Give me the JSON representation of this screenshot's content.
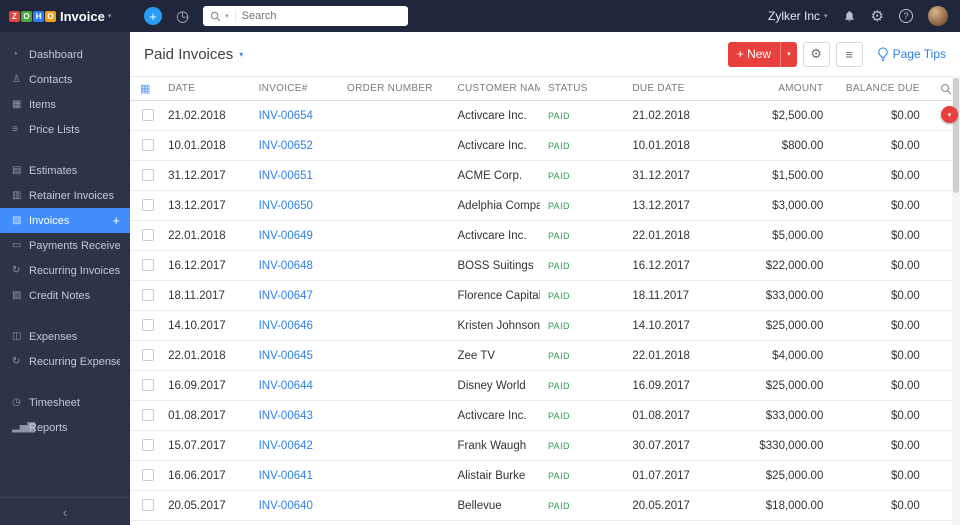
{
  "colors": {
    "accent_blue": "#408dfb",
    "brand_red": "#e8413d",
    "paid_green": "#2e9e4f",
    "link_blue": "#2f80e7",
    "topbar_bg": "#20263b",
    "sidebar_bg": "#2d3448"
  },
  "topbar": {
    "logo": {
      "letters": [
        {
          "ch": "Z",
          "color": "#e2443b"
        },
        {
          "ch": "O",
          "color": "#4ca83d"
        },
        {
          "ch": "H",
          "color": "#2d7ff0"
        },
        {
          "ch": "O",
          "color": "#f0a11b"
        }
      ],
      "product": "Invoice",
      "caret": "▾"
    },
    "icons": {
      "quick_create": "+",
      "history": "◷",
      "settings": "⚙",
      "help": "?"
    },
    "search": {
      "placeholder": "Search",
      "caret": "▾"
    },
    "org": {
      "name": "Zylker Inc",
      "caret": "▾"
    }
  },
  "sidebar": {
    "groups": [
      {
        "items": [
          {
            "label": "Dashboard",
            "icon": "◔"
          },
          {
            "label": "Contacts",
            "icon": "♙"
          },
          {
            "label": "Items",
            "icon": "▦"
          },
          {
            "label": "Price Lists",
            "icon": "≡"
          }
        ]
      },
      {
        "items": [
          {
            "label": "Estimates",
            "icon": "▤"
          },
          {
            "label": "Retainer Invoices",
            "icon": "▥"
          },
          {
            "label": "Invoices",
            "icon": "▧",
            "active": true
          },
          {
            "label": "Payments Received",
            "icon": "▭"
          },
          {
            "label": "Recurring Invoices",
            "icon": "↻"
          },
          {
            "label": "Credit Notes",
            "icon": "▨"
          }
        ]
      },
      {
        "items": [
          {
            "label": "Expenses",
            "icon": "◫"
          },
          {
            "label": "Recurring Expenses",
            "icon": "↻"
          }
        ]
      },
      {
        "items": [
          {
            "label": "Timesheet",
            "icon": "◷"
          },
          {
            "label": "Reports",
            "icon": "▂▅▇"
          }
        ]
      }
    ],
    "collapse_icon": "‹"
  },
  "page": {
    "title": "Paid Invoices",
    "title_caret": "▾",
    "actions": {
      "new_label": "+ New",
      "new_caret": "▾",
      "settings_icon": "⚙",
      "list_icon": "≡",
      "page_tips": "Page Tips"
    }
  },
  "table": {
    "grid_icon": "▦",
    "columns": [
      "DATE",
      "INVOICE#",
      "ORDER NUMBER",
      "CUSTOMER NAME",
      "STATUS",
      "DUE DATE",
      "AMOUNT",
      "BALANCE DUE"
    ],
    "rows": [
      {
        "date": "21.02.2018",
        "invoice": "INV-00654",
        "order": "",
        "customer": "Activcare Inc.",
        "status": "PAID",
        "due": "21.02.2018",
        "amount": "$2,500.00",
        "balance": "$0.00"
      },
      {
        "date": "10.01.2018",
        "invoice": "INV-00652",
        "order": "",
        "customer": "Activcare Inc.",
        "status": "PAID",
        "due": "10.01.2018",
        "amount": "$800.00",
        "balance": "$0.00"
      },
      {
        "date": "31.12.2017",
        "invoice": "INV-00651",
        "order": "",
        "customer": "ACME Corp.",
        "status": "PAID",
        "due": "31.12.2017",
        "amount": "$1,500.00",
        "balance": "$0.00"
      },
      {
        "date": "13.12.2017",
        "invoice": "INV-00650",
        "order": "",
        "customer": "Adelphia Company",
        "status": "PAID",
        "due": "13.12.2017",
        "amount": "$3,000.00",
        "balance": "$0.00"
      },
      {
        "date": "22.01.2018",
        "invoice": "INV-00649",
        "order": "",
        "customer": "Activcare Inc.",
        "status": "PAID",
        "due": "22.01.2018",
        "amount": "$5,000.00",
        "balance": "$0.00"
      },
      {
        "date": "16.12.2017",
        "invoice": "INV-00648",
        "order": "",
        "customer": "BOSS Suitings",
        "status": "PAID",
        "due": "16.12.2017",
        "amount": "$22,000.00",
        "balance": "$0.00"
      },
      {
        "date": "18.11.2017",
        "invoice": "INV-00647",
        "order": "",
        "customer": "Florence Capital",
        "status": "PAID",
        "due": "18.11.2017",
        "amount": "$33,000.00",
        "balance": "$0.00"
      },
      {
        "date": "14.10.2017",
        "invoice": "INV-00646",
        "order": "",
        "customer": "Kristen Johnson",
        "status": "PAID",
        "due": "14.10.2017",
        "amount": "$25,000.00",
        "balance": "$0.00"
      },
      {
        "date": "22.01.2018",
        "invoice": "INV-00645",
        "order": "",
        "customer": "Zee TV",
        "status": "PAID",
        "due": "22.01.2018",
        "amount": "$4,000.00",
        "balance": "$0.00"
      },
      {
        "date": "16.09.2017",
        "invoice": "INV-00644",
        "order": "",
        "customer": "Disney World",
        "status": "PAID",
        "due": "16.09.2017",
        "amount": "$25,000.00",
        "balance": "$0.00"
      },
      {
        "date": "01.08.2017",
        "invoice": "INV-00643",
        "order": "",
        "customer": "Activcare Inc.",
        "status": "PAID",
        "due": "01.08.2017",
        "amount": "$33,000.00",
        "balance": "$0.00"
      },
      {
        "date": "15.07.2017",
        "invoice": "INV-00642",
        "order": "",
        "customer": "Frank Waugh",
        "status": "PAID",
        "due": "30.07.2017",
        "amount": "$330,000.00",
        "balance": "$0.00"
      },
      {
        "date": "16.06.2017",
        "invoice": "INV-00641",
        "order": "",
        "customer": "Alistair Burke",
        "status": "PAID",
        "due": "01.07.2017",
        "amount": "$25,000.00",
        "balance": "$0.00"
      },
      {
        "date": "20.05.2017",
        "invoice": "INV-00640",
        "order": "",
        "customer": "Bellevue",
        "status": "PAID",
        "due": "20.05.2017",
        "amount": "$18,000.00",
        "balance": "$0.00"
      }
    ]
  },
  "floating": {
    "announcement_caret": "▾"
  }
}
